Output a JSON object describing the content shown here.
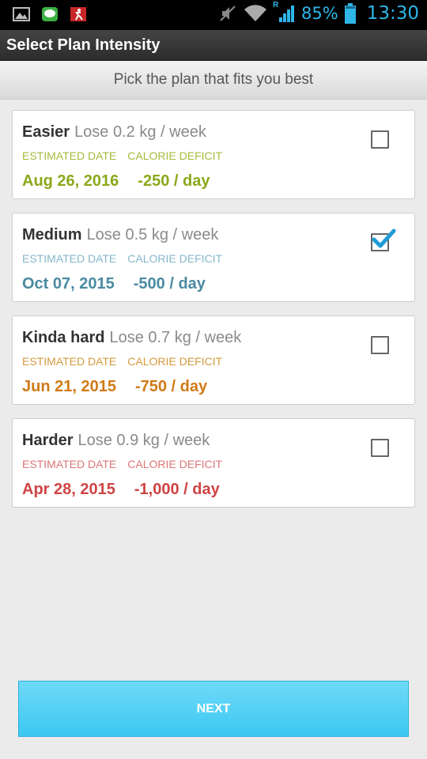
{
  "status_bar": {
    "battery_text": "85%",
    "time": "13:30",
    "network_roaming_label": "R",
    "icons": [
      "gallery-icon",
      "line-app-icon",
      "running-app-icon",
      "mute-icon",
      "wifi-icon",
      "signal-icon",
      "battery-icon"
    ]
  },
  "header": {
    "title": "Select Plan Intensity"
  },
  "subheader": {
    "text": "Pick the plan that fits you best"
  },
  "plans": [
    {
      "name": "Easier",
      "loss": "Lose 0.2 kg / week",
      "date_label": "ESTIMATED DATE",
      "deficit_label": "CALORIE DEFICIT",
      "date": "Aug 26, 2016",
      "deficit": "-250 / day",
      "checked": false,
      "color": "#8ba81a"
    },
    {
      "name": "Medium",
      "loss": "Lose 0.5 kg / week",
      "date_label": "ESTIMATED DATE",
      "deficit_label": "CALORIE DEFICIT",
      "date": "Oct 07, 2015",
      "deficit": "-500 / day",
      "checked": true,
      "color": "#4a8aa1"
    },
    {
      "name": "Kinda hard",
      "loss": "Lose 0.7 kg / week",
      "date_label": "ESTIMATED DATE",
      "deficit_label": "CALORIE DEFICIT",
      "date": "Jun 21, 2015",
      "deficit": "-750 / day",
      "checked": false,
      "color": "#d07a17"
    },
    {
      "name": "Harder",
      "loss": "Lose 0.9 kg / week",
      "date_label": "ESTIMATED DATE",
      "deficit_label": "CALORIE DEFICIT",
      "date": "Apr 28, 2015",
      "deficit": "-1,000 / day",
      "checked": false,
      "color": "#cf4444"
    }
  ],
  "next_button": {
    "label": "NEXT"
  },
  "colors": {
    "accent": "#3cc7f2",
    "checkmark": "#1e9bd7"
  }
}
